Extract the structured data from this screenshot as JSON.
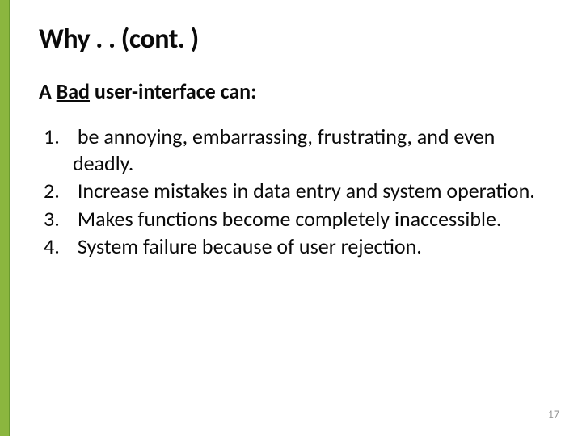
{
  "slide": {
    "title": "Why . . (cont. )",
    "subtitle_prefix": "A ",
    "subtitle_underlined": "Bad",
    "subtitle_suffix": " user-interface can:",
    "items": [
      " be annoying, embarrassing, frustrating, and even deadly.",
      " Increase mistakes in data entry and system operation.",
      " Makes functions become completely inaccessible.",
      " System failure because of user rejection."
    ],
    "page_number": "17"
  }
}
